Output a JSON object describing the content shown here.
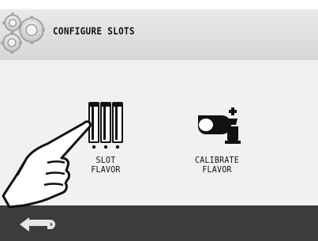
{
  "header": {
    "title": "CONFIGURE SLOTS",
    "icon": "gears-icon"
  },
  "options": [
    {
      "id": "slot-flavor",
      "icon": "cartridges-icon",
      "label_line1": "SLOT",
      "label_line2": "FLAVOR"
    },
    {
      "id": "calibrate-flavor",
      "icon": "pump-bottle-icon",
      "label_line1": "CALIBRATE",
      "label_line2": "FLAVOR"
    }
  ],
  "footer": {
    "back_icon": "back-arrow-icon"
  },
  "overlay": {
    "pointer_icon": "pointing-hand-icon"
  }
}
